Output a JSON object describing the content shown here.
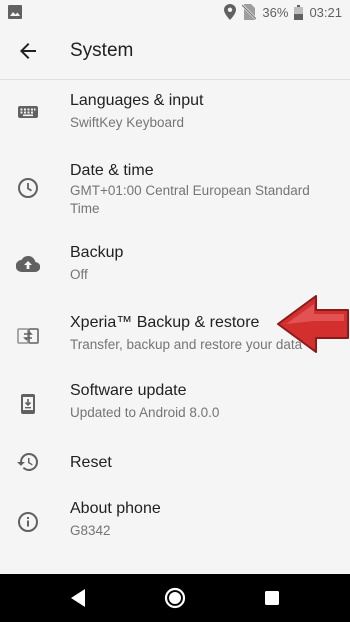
{
  "status_bar": {
    "battery": "36%",
    "time": "03:21"
  },
  "header": {
    "title": "System"
  },
  "items": [
    {
      "label": "Languages & input",
      "sub": "SwiftKey Keyboard",
      "icon": "keyboard-icon"
    },
    {
      "label": "Date & time",
      "sub": "GMT+01:00 Central European Standard Time",
      "icon": "clock-icon"
    },
    {
      "label": "Backup",
      "sub": "Off",
      "icon": "cloud-upload-icon"
    },
    {
      "label": "Xperia™ Backup & restore",
      "sub": "Transfer, backup and restore your data",
      "icon": "transfer-icon"
    },
    {
      "label": "Software update",
      "sub": "Updated to Android 8.0.0",
      "icon": "phone-download-icon"
    },
    {
      "label": "Reset",
      "sub": "",
      "icon": "reset-icon"
    },
    {
      "label": "About phone",
      "sub": "G8342",
      "icon": "info-icon"
    }
  ],
  "colors": {
    "background": "#f5f5f5",
    "icon": "#616161",
    "title": "#212121",
    "subtitle": "#757575",
    "arrow": "#d32f2f",
    "nav_bar": "#000000"
  }
}
